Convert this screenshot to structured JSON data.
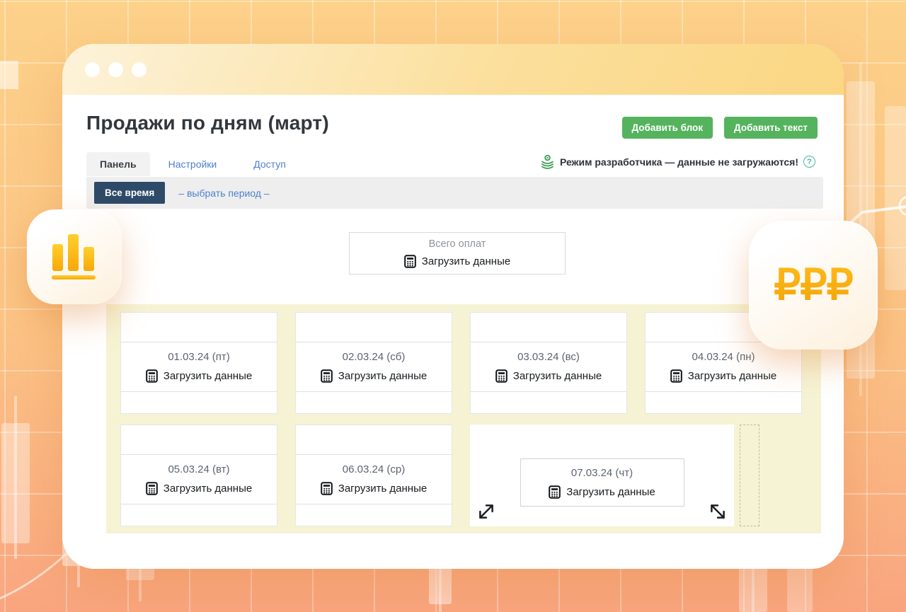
{
  "window": {
    "type": "browser-mock",
    "traffic_dots": 3
  },
  "header": {
    "title": "Продажи по дням (март)",
    "add_block_label": "Добавить блок",
    "add_text_label": "Добавить текст"
  },
  "tabs": [
    {
      "label": "Панель",
      "active": true
    },
    {
      "label": "Настройки",
      "active": false
    },
    {
      "label": "Доступ",
      "active": false
    }
  ],
  "dev_notice": {
    "icon": "api-stack-icon",
    "text": "Режим разработчика — данные не загружаются!",
    "help_icon": "question-circle-icon",
    "help_glyph": "?"
  },
  "filter": {
    "all_time_label": "Все время",
    "period_label": "– выбрать период –"
  },
  "total_widget": {
    "title": "Всего оплат",
    "load_label": "Загрузить данные",
    "icon": "calculator-icon"
  },
  "cards": [
    {
      "date": "01.03.24 (пт)",
      "load_label": "Загрузить данные"
    },
    {
      "date": "02.03.24 (сб)",
      "load_label": "Загрузить данные"
    },
    {
      "date": "03.03.24 (вс)",
      "load_label": "Загрузить данные"
    },
    {
      "date": "04.03.24 (пн)",
      "load_label": "Загрузить данные"
    },
    {
      "date": "05.03.24 (вт)",
      "load_label": "Загрузить данные"
    },
    {
      "date": "06.03.24 (ср)",
      "load_label": "Загрузить данные"
    },
    {
      "date": "07.03.24 (чт)",
      "load_label": "Загрузить данные",
      "state": "resizing"
    }
  ],
  "floating_icons": {
    "left": "bar-chart-icon",
    "right_text": "₽₽₽"
  },
  "colors": {
    "accent_green": "#55b35e",
    "navy_button": "#2d4a68",
    "link_blue": "#4d80cf",
    "cards_background": "#f5f3d4",
    "gold": "#f5ac0e",
    "teal_help": "#43b79e",
    "background_top": "#fcd189",
    "background_bottom": "#f9a57f"
  }
}
